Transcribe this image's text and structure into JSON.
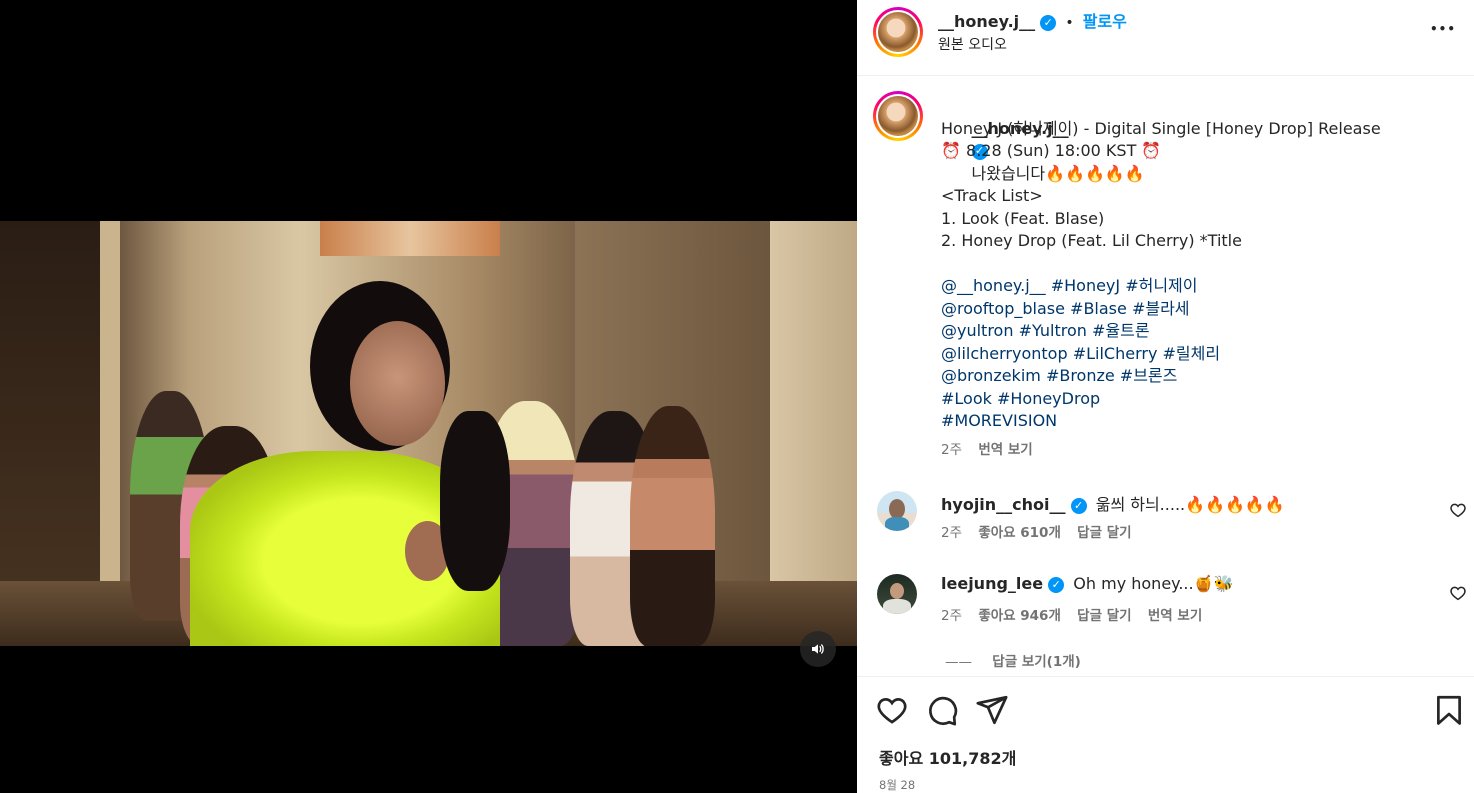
{
  "post": {
    "username": "__honey.j__",
    "follow_label": "팔로우",
    "separator": "•",
    "audio_label": "원본 오디오",
    "more_label": "•••"
  },
  "caption": {
    "username": "__honey.j__",
    "first_line": "나왔습니다🔥🔥🔥🔥🔥",
    "lines": [
      "Honey J (허니제이) - Digital Single [Honey Drop] Release",
      "⏰ 8.28 (Sun) 18:00 KST ⏰",
      "",
      "<Track List>",
      "1. Look (Feat. Blase)",
      "2. Honey Drop (Feat. Lil Cherry) *Title",
      ""
    ],
    "tag_lines": [
      "@__honey.j__ #HoneyJ #허니제이",
      "@rooftop_blase #Blase #블라세",
      "@yultron #Yultron #율트론",
      "@lilcherryontop #LilCherry #릴체리",
      "@bronzekim #Bronze #브론즈",
      "#Look #HoneyDrop",
      "#MOREVISION"
    ],
    "time": "2주",
    "translate": "번역 보기"
  },
  "comments": [
    {
      "username": "hyojin__choi__",
      "text": "욺씌 하늬.....🔥🔥🔥🔥🔥",
      "time": "2주",
      "likes": "좋아요 610개",
      "reply": "답글 달기",
      "translate": ""
    },
    {
      "username": "leejung_lee",
      "text": "Oh my honey...🍯🐝",
      "time": "2주",
      "likes": "좋아요 946개",
      "reply": "답글 달기",
      "translate": "번역 보기"
    }
  ],
  "replies_toggle": {
    "dash": "——",
    "label": "답글 보기(1개)"
  },
  "footer": {
    "likes": "좋아요 101,782개",
    "date": "8월 28"
  },
  "colors": {
    "verified": "#0095f6",
    "tag_blue": "#00376b",
    "follow_blue": "#0095f6",
    "muted": "#737373"
  },
  "icons": [
    "heart-icon",
    "comment-icon",
    "share-icon",
    "bookmark-icon",
    "speaker-icon",
    "more-icon",
    "verified-icon"
  ]
}
